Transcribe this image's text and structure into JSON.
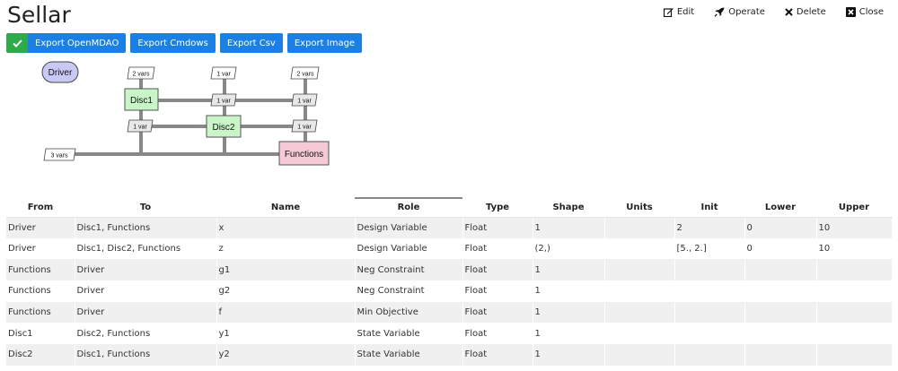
{
  "page": {
    "title": "Sellar"
  },
  "nav": [
    {
      "id": "edit",
      "label": "Edit",
      "icon": "edit-icon"
    },
    {
      "id": "operate",
      "label": "Operate",
      "icon": "rocket-icon"
    },
    {
      "id": "delete",
      "label": "Delete",
      "icon": "times-icon"
    },
    {
      "id": "close",
      "label": "Close",
      "icon": "close-box-icon"
    }
  ],
  "toolbar": {
    "export_openmdao": "Export OpenMDAO",
    "export_cmdows": "Export Cmdows",
    "export_csv": "Export Csv",
    "export_image": "Export Image",
    "primary_color": "#1a7fe6",
    "ok_color": "#2eaa48"
  },
  "xdsm": {
    "driver": "Driver",
    "disc1": "Disc1",
    "disc2": "Disc2",
    "functions": "Functions",
    "top_row": [
      "2 vars",
      "1 var",
      "2 vars"
    ],
    "row1": [
      "1 var",
      "1 var"
    ],
    "row2": [
      "1 var",
      "1 var"
    ],
    "left_in": "3 vars"
  },
  "table": {
    "headers": [
      "From",
      "To",
      "Name",
      "Role",
      "Type",
      "Shape",
      "Units",
      "Init",
      "Lower",
      "Upper"
    ],
    "rows": [
      [
        "Driver",
        "Disc1, Functions",
        "x",
        "Design Variable",
        "Float",
        "1",
        "",
        "2",
        "0",
        "10"
      ],
      [
        "Driver",
        "Disc1, Disc2, Functions",
        "z",
        "Design Variable",
        "Float",
        "(2,)",
        "",
        "[5., 2.]",
        "0",
        "10"
      ],
      [
        "Functions",
        "Driver",
        "g1",
        "Neg Constraint",
        "Float",
        "1",
        "",
        "",
        "",
        ""
      ],
      [
        "Functions",
        "Driver",
        "g2",
        "Neg Constraint",
        "Float",
        "1",
        "",
        "",
        "",
        ""
      ],
      [
        "Functions",
        "Driver",
        "f",
        "Min Objective",
        "Float",
        "1",
        "",
        "",
        "",
        ""
      ],
      [
        "Disc1",
        "Disc2, Functions",
        "y1",
        "State Variable",
        "Float",
        "1",
        "",
        "",
        "",
        ""
      ],
      [
        "Disc2",
        "Disc1, Functions",
        "y2",
        "State Variable",
        "Float",
        "1",
        "",
        "",
        "",
        ""
      ]
    ]
  }
}
